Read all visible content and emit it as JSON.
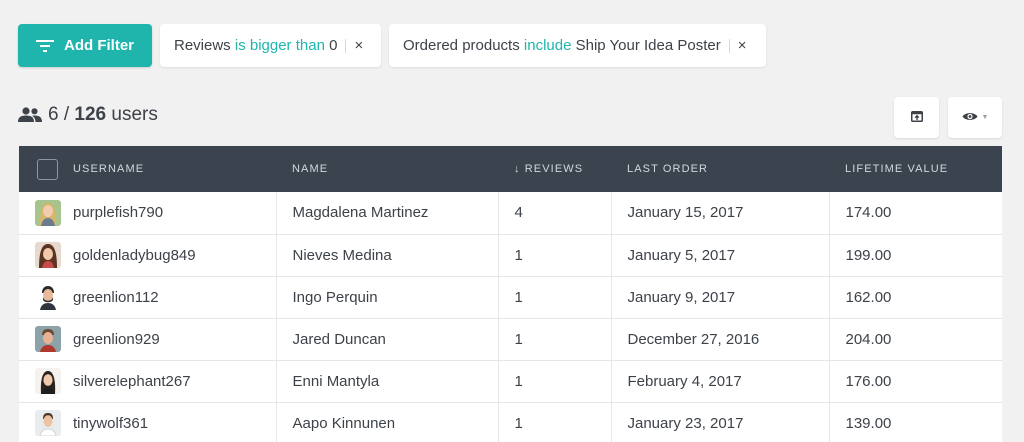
{
  "toolbar": {
    "add_filter_label": "Add Filter",
    "filters": [
      {
        "field": "Reviews",
        "operator": "is bigger than",
        "value": "0"
      },
      {
        "field": "Ordered products",
        "operator": "include",
        "value": "Ship Your Idea Poster"
      }
    ],
    "close_glyph": "×"
  },
  "summary": {
    "shown": "6 / ",
    "total": "126",
    "unit": " users"
  },
  "table": {
    "headers": {
      "username": "USERNAME",
      "name": "NAME",
      "reviews": "↓ REVIEWS",
      "last_order": "LAST ORDER",
      "lifetime_value": "LIFETIME VALUE"
    },
    "rows": [
      {
        "username": "purplefish790",
        "name": "Magdalena Martinez",
        "reviews": "4",
        "last_order": "January 15, 2017",
        "lifetime_value": "174.00",
        "avatar": "avatar-blonde-woman"
      },
      {
        "username": "goldenladybug849",
        "name": "Nieves Medina",
        "reviews": "1",
        "last_order": "January 5, 2017",
        "lifetime_value": "199.00",
        "avatar": "avatar-brunette-woman"
      },
      {
        "username": "greenlion112",
        "name": "Ingo Perquin",
        "reviews": "1",
        "last_order": "January 9, 2017",
        "lifetime_value": "162.00",
        "avatar": "avatar-bearded-man"
      },
      {
        "username": "greenlion929",
        "name": "Jared Duncan",
        "reviews": "1",
        "last_order": "December 27, 2016",
        "lifetime_value": "204.00",
        "avatar": "avatar-man-outdoors"
      },
      {
        "username": "silverelephant267",
        "name": "Enni Mantyla",
        "reviews": "1",
        "last_order": "February 4, 2017",
        "lifetime_value": "176.00",
        "avatar": "avatar-dark-hair-woman"
      },
      {
        "username": "tinywolf361",
        "name": "Aapo Kinnunen",
        "reviews": "1",
        "last_order": "January 23, 2017",
        "lifetime_value": "139.00",
        "avatar": "avatar-man-shirt"
      }
    ]
  },
  "colors": {
    "accent": "#1fb5ac",
    "header_bg": "#3a434e",
    "page_bg": "#f1f1f1"
  },
  "icons": {
    "filter": "filter-icon",
    "users": "users-icon",
    "export": "export-icon",
    "view": "eye-icon"
  }
}
